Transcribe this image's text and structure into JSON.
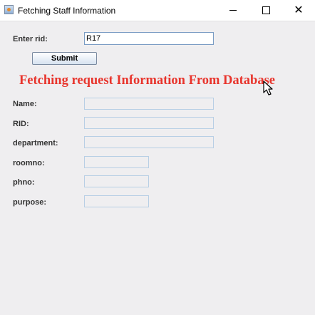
{
  "window": {
    "title": "Fetching Staff Information",
    "controls": [
      "minimize",
      "maximize",
      "close"
    ]
  },
  "form": {
    "rid_label": "Enter rid:",
    "rid_value": "R17",
    "submit_label": "Submit"
  },
  "heading": {
    "text": "Fetching request Information From Database",
    "color": "#e8342c"
  },
  "fields": [
    {
      "label": "Name:",
      "value": ""
    },
    {
      "label": "RID:",
      "value": ""
    },
    {
      "label": "department:",
      "value": ""
    },
    {
      "label": "roomno:",
      "value": ""
    },
    {
      "label": "phno:",
      "value": ""
    },
    {
      "label": "purpose:",
      "value": ""
    }
  ]
}
